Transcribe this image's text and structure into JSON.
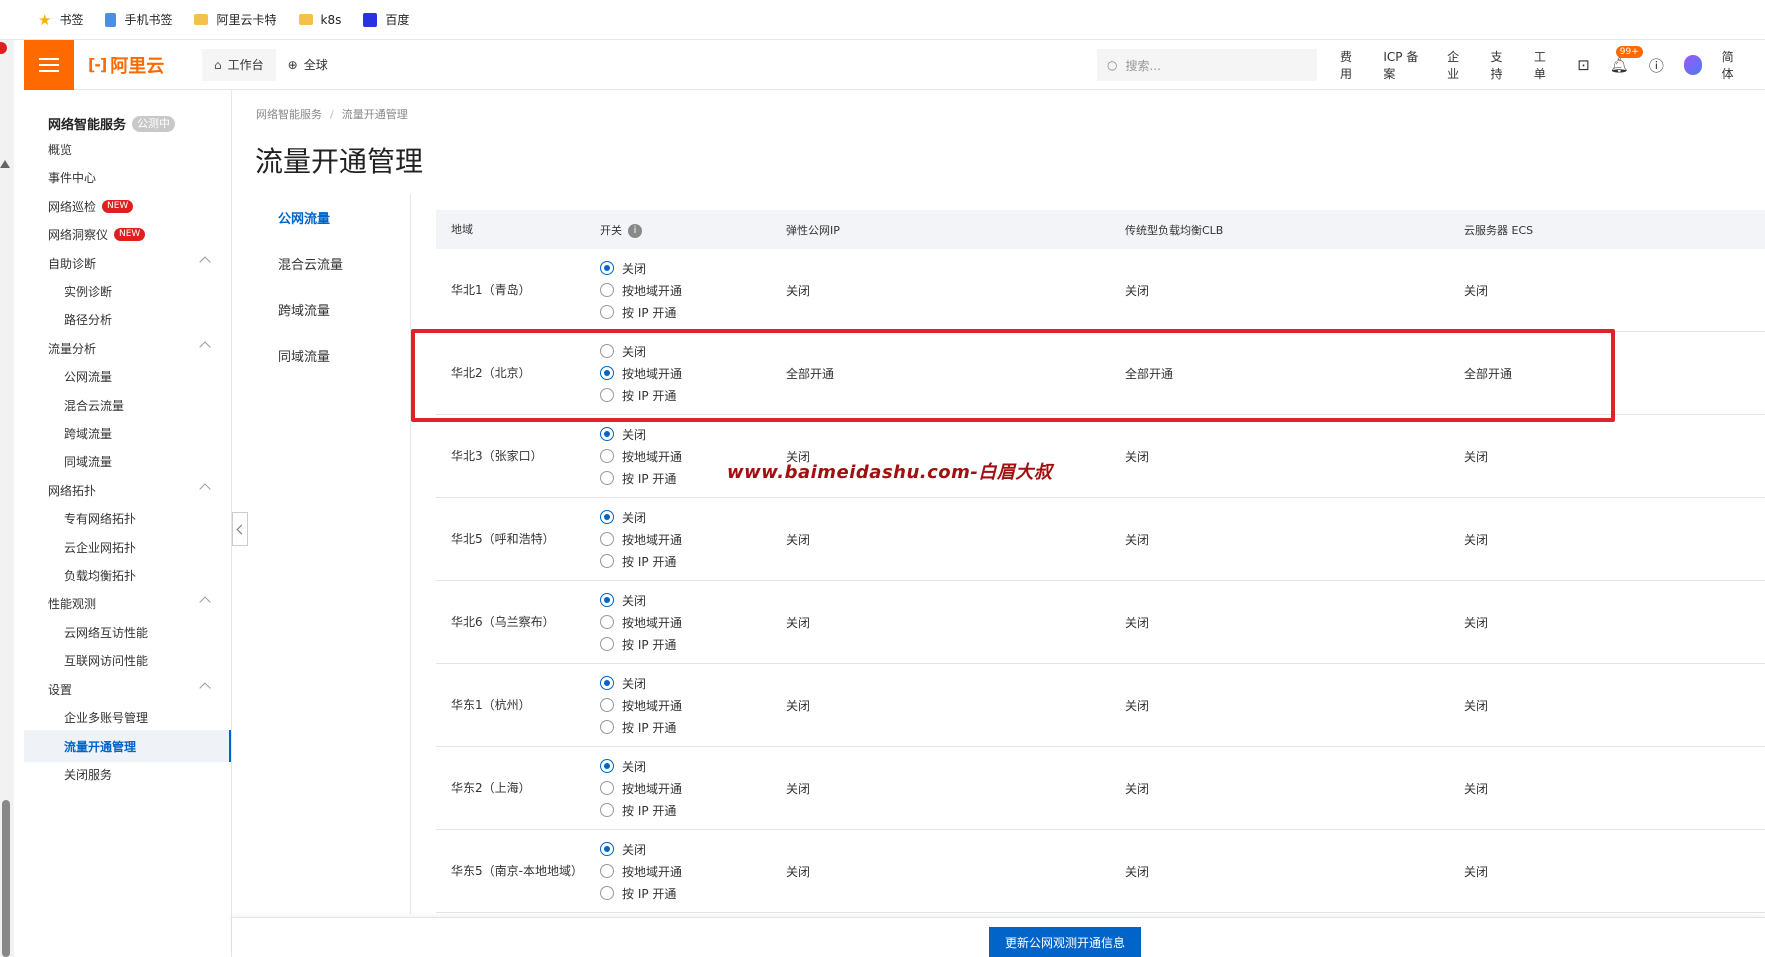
{
  "bookmarks": [
    {
      "label": "书签",
      "icon": "star-icon"
    },
    {
      "label": "手机书签",
      "icon": "phone-icon"
    },
    {
      "label": "阿里云卡特",
      "icon": "folder-icon"
    },
    {
      "label": "k8s",
      "icon": "folder-icon"
    },
    {
      "label": "百度",
      "icon": "baidu-icon"
    }
  ],
  "topnav": {
    "logo_text": "阿里云",
    "workbench": "工作台",
    "region": "全球",
    "search_placeholder": "搜索...",
    "links": [
      "费用",
      "ICP 备案",
      "企业",
      "支持",
      "工单"
    ],
    "notif_badge": "99+",
    "lang": "简体",
    "accent": "#ff6a00"
  },
  "sidebar": {
    "title": "网络智能服务",
    "title_tag": "公测中",
    "items": [
      {
        "label": "概览",
        "level": 1
      },
      {
        "label": "事件中心",
        "level": 1
      },
      {
        "label": "网络巡检",
        "level": 1,
        "badge": "NEW"
      },
      {
        "label": "网络洞察仪",
        "level": 1,
        "badge": "NEW"
      },
      {
        "label": "自助诊断",
        "level": 1,
        "group": true
      },
      {
        "label": "实例诊断",
        "level": 2
      },
      {
        "label": "路径分析",
        "level": 2
      },
      {
        "label": "流量分析",
        "level": 1,
        "group": true
      },
      {
        "label": "公网流量",
        "level": 2
      },
      {
        "label": "混合云流量",
        "level": 2
      },
      {
        "label": "跨域流量",
        "level": 2
      },
      {
        "label": "同域流量",
        "level": 2
      },
      {
        "label": "网络拓扑",
        "level": 1,
        "group": true
      },
      {
        "label": "专有网络拓扑",
        "level": 2
      },
      {
        "label": "云企业网拓扑",
        "level": 2
      },
      {
        "label": "负载均衡拓扑",
        "level": 2
      },
      {
        "label": "性能观测",
        "level": 1,
        "group": true
      },
      {
        "label": "云网络互访性能",
        "level": 2
      },
      {
        "label": "互联网访问性能",
        "level": 2
      },
      {
        "label": "设置",
        "level": 1,
        "group": true
      },
      {
        "label": "企业多账号管理",
        "level": 2
      },
      {
        "label": "流量开通管理",
        "level": 2,
        "active": true
      },
      {
        "label": "关闭服务",
        "level": 2
      }
    ]
  },
  "breadcrumb": [
    "网络智能服务",
    "流量开通管理"
  ],
  "page_title": "流量开通管理",
  "tabs": [
    {
      "label": "公网流量",
      "active": true
    },
    {
      "label": "混合云流量"
    },
    {
      "label": "跨域流量"
    },
    {
      "label": "同域流量"
    }
  ],
  "table": {
    "headers": [
      "地域",
      "开关",
      "弹性公网IP",
      "传统型负载均衡CLB",
      "云服务器 ECS"
    ],
    "radio_options": [
      "关闭",
      "按地域开通",
      "按 IP 开通"
    ],
    "rows": [
      {
        "region": "华北1（青岛）",
        "selected": 0,
        "eip": "关闭",
        "clb": "关闭",
        "ecs": "关闭"
      },
      {
        "region": "华北2（北京）",
        "selected": 1,
        "eip": "全部开通",
        "clb": "全部开通",
        "ecs": "全部开通"
      },
      {
        "region": "华北3（张家口）",
        "selected": 0,
        "eip": "关闭",
        "clb": "关闭",
        "ecs": "关闭"
      },
      {
        "region": "华北5（呼和浩特）",
        "selected": 0,
        "eip": "关闭",
        "clb": "关闭",
        "ecs": "关闭"
      },
      {
        "region": "华北6（乌兰察布）",
        "selected": 0,
        "eip": "关闭",
        "clb": "关闭",
        "ecs": "关闭"
      },
      {
        "region": "华东1（杭州）",
        "selected": 0,
        "eip": "关闭",
        "clb": "关闭",
        "ecs": "关闭"
      },
      {
        "region": "华东2（上海）",
        "selected": 0,
        "eip": "关闭",
        "clb": "关闭",
        "ecs": "关闭"
      },
      {
        "region": "华东5（南京-本地地域）",
        "selected": 0,
        "eip": "关闭",
        "clb": "关闭",
        "ecs": "关闭"
      }
    ]
  },
  "watermark": "www.baimeidashu.com-白眉大叔",
  "footer": {
    "update_button": "更新公网观测开通信息"
  },
  "colors": {
    "primary": "#0064c8",
    "highlight": "#e0222b",
    "new_badge": "#e02020"
  }
}
